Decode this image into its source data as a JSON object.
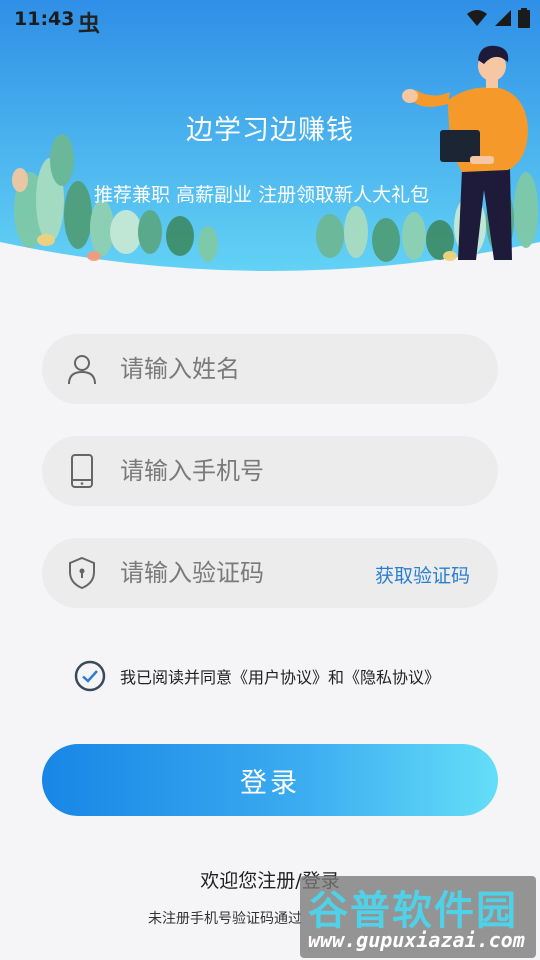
{
  "status_bar": {
    "time": "11:43",
    "app_icon_glyph": "虫"
  },
  "hero": {
    "title": "边学习边赚钱",
    "subtitle": "推荐兼职 高薪副业 注册领取新人大礼包"
  },
  "form": {
    "name_placeholder": "请输入姓名",
    "phone_placeholder": "请输入手机号",
    "code_placeholder": "请输入验证码",
    "get_code_label": "获取验证码"
  },
  "agreement": {
    "checked": true,
    "text": "我已阅读并同意《用户协议》和《隐私协议》"
  },
  "login_button_label": "登录",
  "welcome_text": "欢迎您注册/登录",
  "notice_text": "未注册手机号验证码通过",
  "watermark": {
    "logo": "谷普软件园",
    "url": "www.gupuxiazai.com"
  },
  "colors": {
    "accent": "#2a7fd1",
    "hero_top": "#2f8fe6",
    "hero_bottom": "#63d2f5",
    "button_start": "#1786e6",
    "button_end": "#64def8"
  }
}
